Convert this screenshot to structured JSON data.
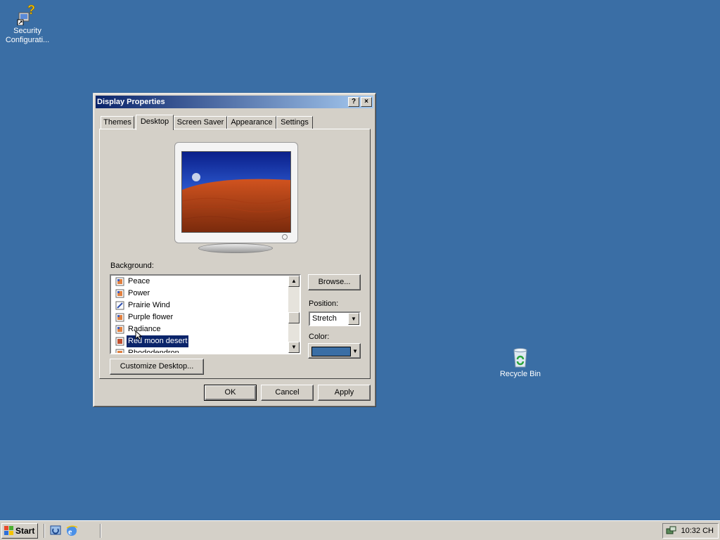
{
  "desktop": {
    "icons": [
      {
        "label": "Security Configurati...",
        "icon": "security-configuration-icon"
      },
      {
        "label": "Recycle Bin",
        "icon": "recycle-bin-icon"
      }
    ],
    "background_color": "#3a6ea5"
  },
  "dialog": {
    "title": "Display Properties",
    "help_button": "?",
    "close_button": "×",
    "tabs": [
      "Themes",
      "Desktop",
      "Screen Saver",
      "Appearance",
      "Settings"
    ],
    "active_tab": "Desktop",
    "background_label": "Background:",
    "background_items": [
      {
        "label": "Peace",
        "icon": "image-file-icon"
      },
      {
        "label": "Power",
        "icon": "image-file-icon"
      },
      {
        "label": "Prairie Wind",
        "icon": "image-file-icon"
      },
      {
        "label": "Purple flower",
        "icon": "image-file-icon"
      },
      {
        "label": "Radiance",
        "icon": "image-file-icon"
      },
      {
        "label": "Red moon desert",
        "icon": "image-file-icon",
        "selected": true
      },
      {
        "label": "Rhododendron",
        "icon": "image-file-icon"
      }
    ],
    "browse_button": "Browse...",
    "position_label": "Position:",
    "position_value": "Stretch",
    "color_label": "Color:",
    "color_value": "#3a6ea5",
    "customize_button": "Customize Desktop...",
    "ok_button": "OK",
    "cancel_button": "Cancel",
    "apply_button": "Apply"
  },
  "taskbar": {
    "start_label": "Start",
    "clock": "10:32 CH"
  }
}
